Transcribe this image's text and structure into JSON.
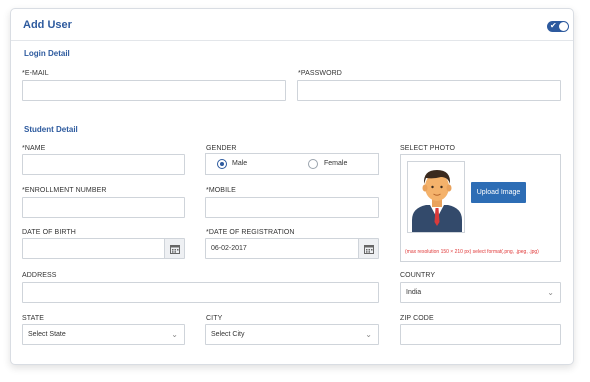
{
  "header": {
    "title": "Add User",
    "toggle_check": "✔"
  },
  "login": {
    "section_title": "Login Detail",
    "email": {
      "label": "*E-MAIL",
      "value": ""
    },
    "password": {
      "label": "*PASSWORD",
      "value": ""
    }
  },
  "student": {
    "section_title": "Student Detail",
    "name": {
      "label": "*NAME",
      "value": ""
    },
    "gender": {
      "label": "GENDER",
      "options": [
        "Male",
        "Female"
      ],
      "selected": "Male"
    },
    "photo": {
      "label": "SELECT PHOTO",
      "upload_label": "Upload Image",
      "note": "(max resolution 150 × 210 px) select format(.png, .jpeg, .jpg)"
    },
    "enrollment": {
      "label": "*ENROLLMENT NUMBER",
      "value": ""
    },
    "mobile": {
      "label": "*MOBILE",
      "value": ""
    },
    "dob": {
      "label": "DATE OF BIRTH",
      "value": ""
    },
    "registration": {
      "label": "*DATE OF REGISTRATION",
      "value": "06-02-2017"
    },
    "address": {
      "label": "ADDRESS",
      "value": ""
    },
    "country": {
      "label": "COUNTRY",
      "value": "India"
    },
    "state": {
      "label": "STATE",
      "value": "Select State"
    },
    "city": {
      "label": "CITY",
      "value": "Select City"
    },
    "zip": {
      "label": "ZIP CODE",
      "value": ""
    }
  },
  "colors": {
    "accent": "#2d5a9e",
    "button": "#2d6db5",
    "note": "#e03a3a"
  }
}
